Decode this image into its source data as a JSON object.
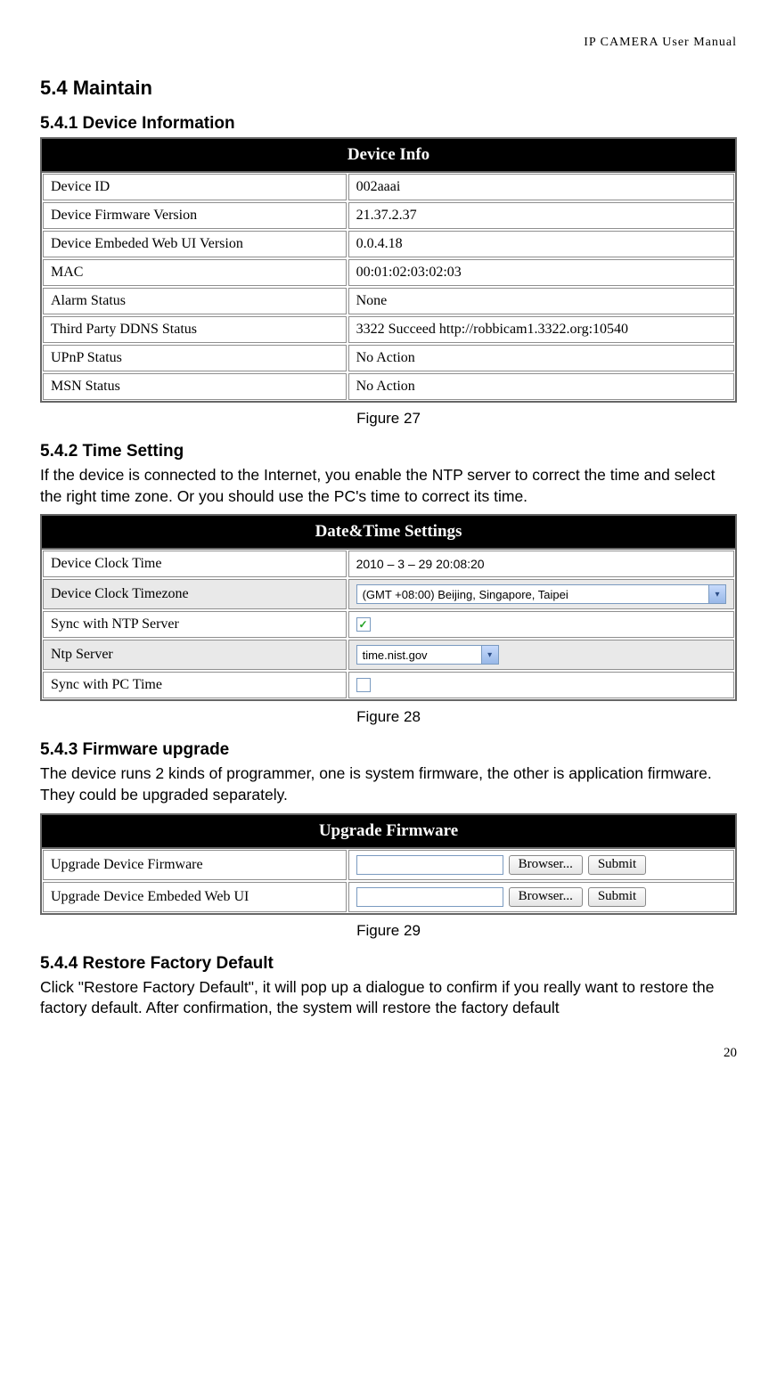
{
  "running_header": "IP  CAMERA  User  Manual",
  "page_number": "20",
  "section_5_4": "5.4   Maintain",
  "section_5_4_1": "5.4.1   Device Information",
  "fig27": "Figure 27",
  "device_info": {
    "title": "Device Info",
    "rows": [
      {
        "label": "Device ID",
        "value": "002aaai"
      },
      {
        "label": "Device Firmware Version",
        "value": "21.37.2.37"
      },
      {
        "label": "Device Embeded Web UI Version",
        "value": "0.0.4.18"
      },
      {
        "label": "MAC",
        "value": "00:01:02:03:02:03"
      },
      {
        "label": "Alarm Status",
        "value": "None"
      },
      {
        "label": "Third Party DDNS Status",
        "value": "3322 Succeed  http://robbicam1.3322.org:10540"
      },
      {
        "label": "UPnP Status",
        "value": "No Action"
      },
      {
        "label": "MSN Status",
        "value": "No Action"
      }
    ]
  },
  "section_5_4_2": "5.4.2   Time Setting",
  "time_para": "If the device is connected to the Internet, you enable the NTP server to correct the time and select the right time zone. Or you should use the PC's time to correct its time.",
  "fig28": "Figure 28",
  "datetime": {
    "title": "Date&Time Settings",
    "clock_label": "Device Clock Time",
    "clock_value": "2010 – 3 – 29      20:08:20",
    "tz_label": "Device Clock Timezone",
    "tz_value": "(GMT +08:00) Beijing, Singapore, Taipei",
    "ntp_sync_label": "Sync with NTP Server",
    "ntp_server_label": "Ntp Server",
    "ntp_server_value": "time.nist.gov",
    "pc_sync_label": "Sync with PC Time"
  },
  "section_5_4_3": "5.4.3   Firmware upgrade",
  "fw_para": "The device runs 2 kinds of programmer, one is system firmware, the other is application firmware. They could be upgraded separately.",
  "fig29": "Figure 29",
  "upgrade": {
    "title": "Upgrade Firmware",
    "row1_label": "Upgrade Device Firmware",
    "row2_label": "Upgrade Device Embeded Web UI",
    "browse": "Browser...",
    "submit": "Submit"
  },
  "section_5_4_4": "5.4.4   Restore Factory Default",
  "restore_para": "Click \"Restore Factory Default\", it will pop up a dialogue to confirm if you really want to restore the factory default. After confirmation, the system will restore the factory default"
}
